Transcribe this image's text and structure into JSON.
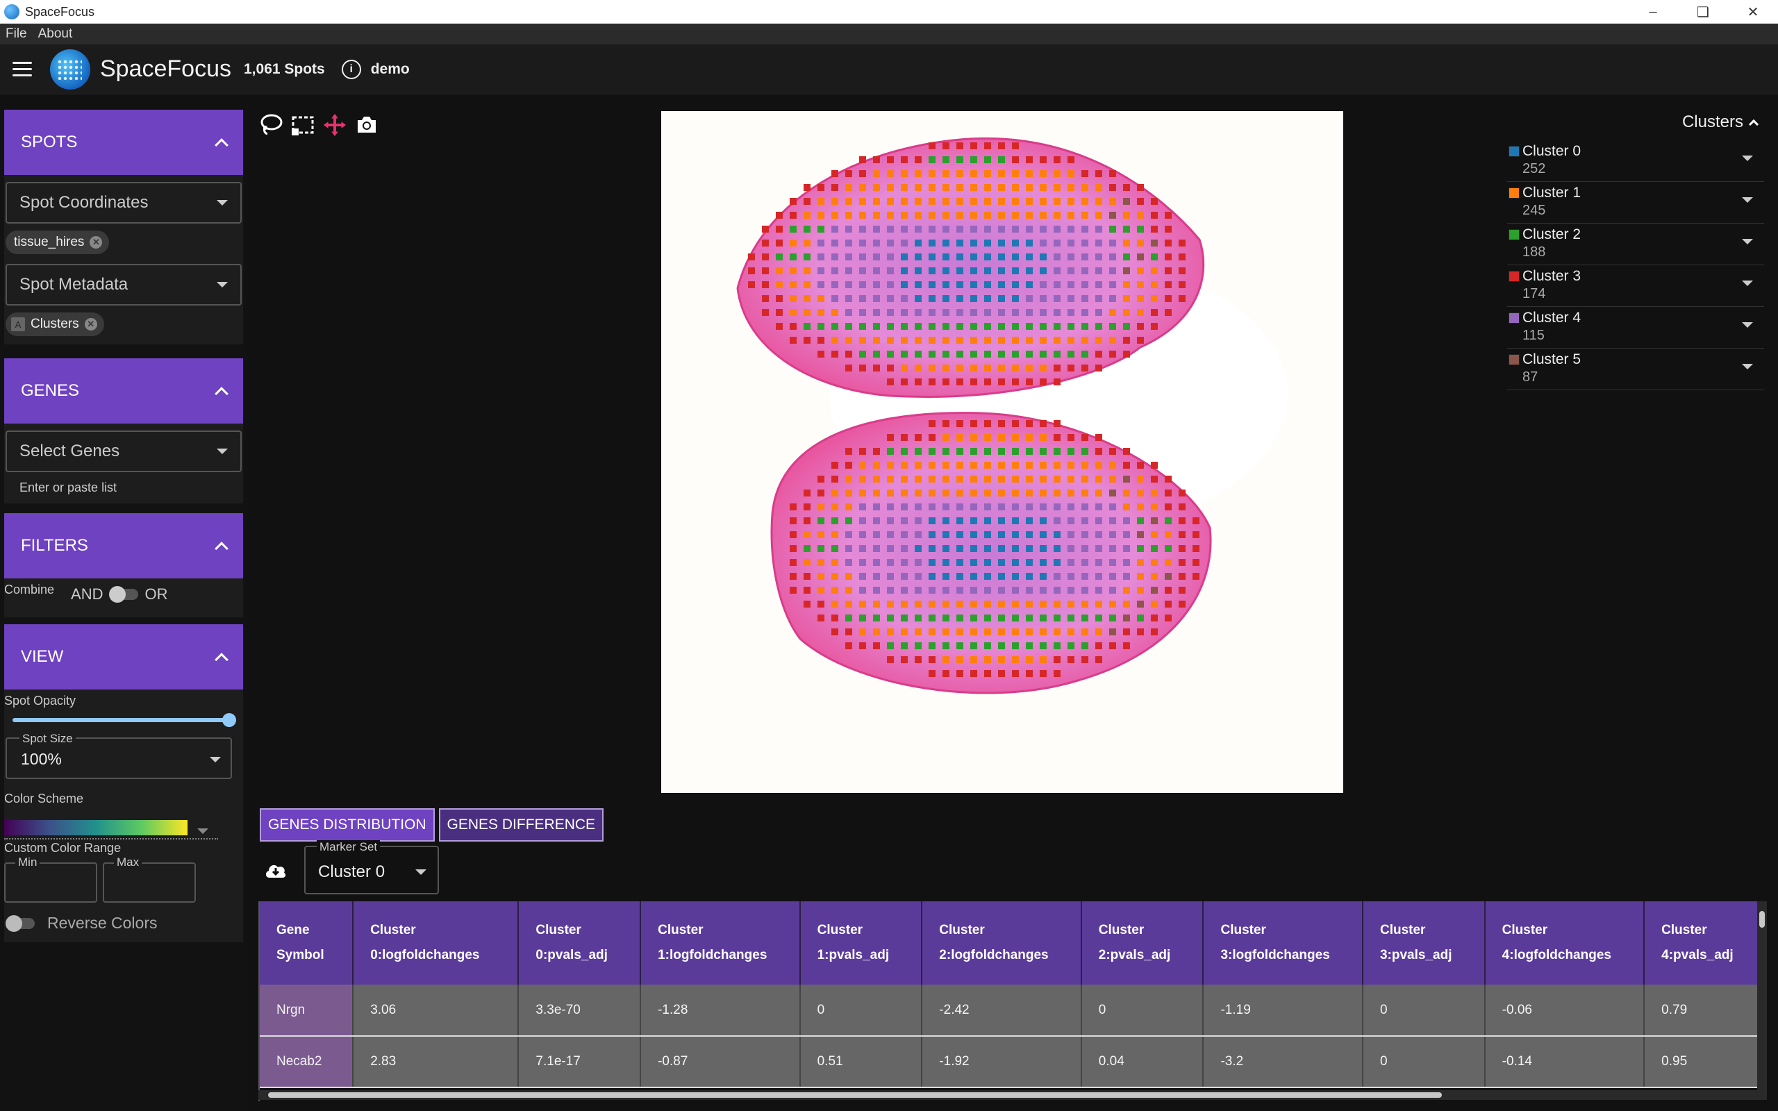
{
  "window": {
    "title": "SpaceFocus"
  },
  "menu": {
    "file": "File",
    "about": "About"
  },
  "header": {
    "brand": "SpaceFocus",
    "spots": "1,061 Spots",
    "dataset": "demo",
    "info_glyph": "i"
  },
  "sidebar": {
    "spots": {
      "title": "SPOTS",
      "coords_label": "Spot Coordinates",
      "coords_chip": "tissue_hires",
      "metadata_label": "Spot Metadata",
      "metadata_chip": "Clusters",
      "metadata_chip_icon": "A"
    },
    "genes": {
      "title": "GENES",
      "select_label": "Select Genes",
      "hint": "Enter or paste list"
    },
    "filters": {
      "title": "FILTERS",
      "combine": "Combine",
      "and": "AND",
      "or": "OR"
    },
    "view": {
      "title": "VIEW",
      "opacity_label": "Spot Opacity",
      "opacity_value": 1.0,
      "size_label": "Spot Size",
      "size_value": "100%",
      "color_scheme_label": "Color Scheme",
      "custom_range_label": "Custom Color Range",
      "min_label": "Min",
      "max_label": "Max",
      "reverse_label": "Reverse Colors"
    }
  },
  "legend": {
    "title": "Clusters",
    "items": [
      {
        "name": "Cluster 0",
        "count": "252",
        "color": "#1f77b4"
      },
      {
        "name": "Cluster 1",
        "count": "245",
        "color": "#ff7f0e"
      },
      {
        "name": "Cluster 2",
        "count": "188",
        "color": "#2ca02c"
      },
      {
        "name": "Cluster 3",
        "count": "174",
        "color": "#d62728"
      },
      {
        "name": "Cluster 4",
        "count": "115",
        "color": "#9467bd"
      },
      {
        "name": "Cluster 5",
        "count": "87",
        "color": "#8c564b"
      }
    ]
  },
  "tabs": {
    "distribution": "GENES DISTRIBUTION",
    "difference": "GENES DIFFERENCE"
  },
  "marker": {
    "label": "Marker Set",
    "value": "Cluster 0"
  },
  "table": {
    "headers": [
      "Gene Symbol",
      "Cluster 0:logfoldchanges",
      "Cluster 0:pvals_adj",
      "Cluster 1:logfoldchanges",
      "Cluster 1:pvals_adj",
      "Cluster 2:logfoldchanges",
      "Cluster 2:pvals_adj",
      "Cluster 3:logfoldchanges",
      "Cluster 3:pvals_adj",
      "Cluster 4:logfoldchanges",
      "Cluster 4:pvals_adj"
    ],
    "rows": [
      [
        "Nrgn",
        "3.06",
        "3.3e-70",
        "-1.28",
        "0",
        "-2.42",
        "0",
        "-1.19",
        "0",
        "-0.06",
        "0.79"
      ],
      [
        "Necab2",
        "2.83",
        "7.1e-17",
        "-0.87",
        "0.51",
        "-1.92",
        "0.04",
        "-3.2",
        "0",
        "-0.14",
        "0.95"
      ]
    ]
  },
  "colors": {
    "accent": "#6f42c1",
    "tab_inactive": "#4a2f80",
    "move_tool": "#e8336d"
  }
}
